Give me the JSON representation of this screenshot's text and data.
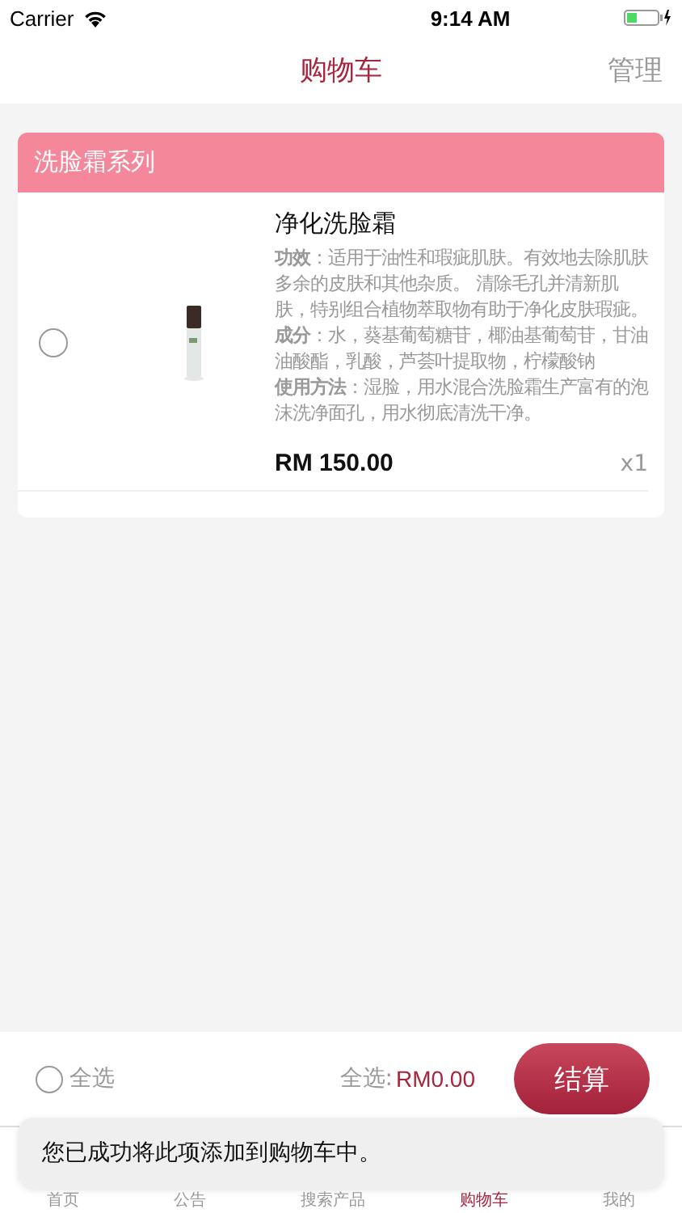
{
  "status_bar": {
    "carrier": "Carrier",
    "time": "9:14 AM"
  },
  "nav": {
    "title": "购物车",
    "action": "管理"
  },
  "cart_group": {
    "title": "洗脸霜系列",
    "items": [
      {
        "selected": false,
        "name": "净化洗脸霜",
        "description": [
          "**功效**：适用于油性和瑕疵肌肤。有效地去除肌肤多余的皮肤和其他杂质。 清除毛孔并清新肌肤，特别组合植物萃取物有助于净化皮肤瑕疵。",
          "**成分**：水，葵基葡萄糖苷，椰油基葡萄苷，甘油油酸酯，乳酸，芦荟叶提取物，柠檬酸钠",
          "**使用方法**：湿脸，用水混合洗脸霜生产富有的泡沫洗净面孔，用水彻底清洗干净。"
        ],
        "price": "RM 150.00",
        "quantity": "x1"
      }
    ]
  },
  "footer": {
    "select_all": {
      "label": "全选",
      "selected": false
    },
    "total_label": "全选:",
    "total": "RM0.00",
    "checkout": "结算"
  },
  "tab_bar": [
    {
      "label": "首页",
      "selected": false
    },
    {
      "label": "公告",
      "selected": false
    },
    {
      "label": "搜索产品",
      "selected": false
    },
    {
      "label": "购物车",
      "selected": true
    },
    {
      "label": "我的",
      "selected": false
    }
  ],
  "toast": "您已成功将此项添加到购物车中。"
}
